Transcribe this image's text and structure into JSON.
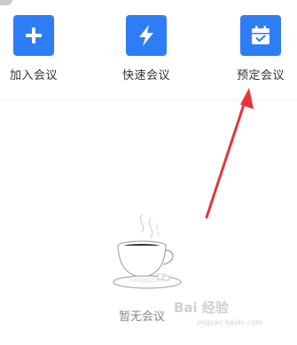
{
  "actions": [
    {
      "label": "加入会议",
      "icon": "plus-icon"
    },
    {
      "label": "快速会议",
      "icon": "lightning-icon"
    },
    {
      "label": "预定会议",
      "icon": "calendar-check-icon"
    }
  ],
  "empty_state": {
    "message": "暂无会议",
    "icon": "coffee-cup-icon"
  },
  "annotation": {
    "icon": "red-arrow-icon",
    "color": "#e8343a"
  },
  "watermark": {
    "text": "Bai 经验",
    "sub": "jingyan.baidu.com"
  },
  "colors": {
    "accent": "#2f7df6"
  }
}
